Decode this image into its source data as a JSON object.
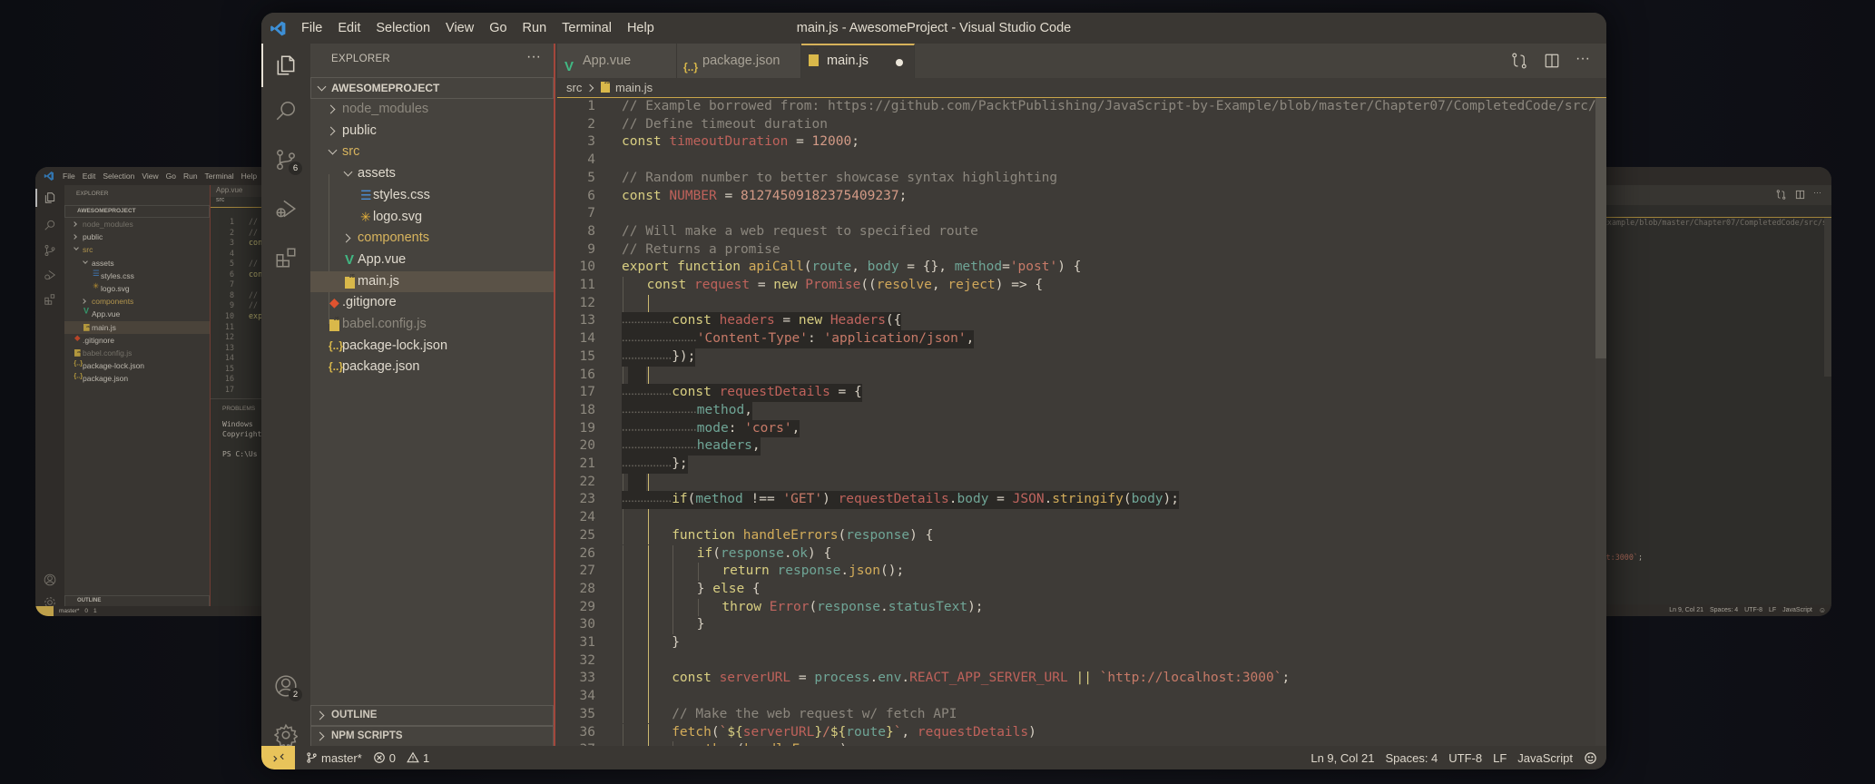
{
  "window": {
    "title": "main.js - AwesomeProject - Visual Studio Code",
    "menu": [
      "File",
      "Edit",
      "Selection",
      "View",
      "Go",
      "Run",
      "Terminal",
      "Help"
    ]
  },
  "activity_bar": {
    "items": [
      {
        "icon": "files-icon",
        "active": true
      },
      {
        "icon": "search-icon"
      },
      {
        "icon": "source-control-icon",
        "badge": "6"
      },
      {
        "icon": "run-debug-icon"
      },
      {
        "icon": "extensions-icon"
      }
    ],
    "accounts_badge": "2",
    "bottom": [
      "accounts-icon",
      "gear-icon"
    ]
  },
  "explorer": {
    "title": "EXPLORER",
    "more": "···",
    "project": "AWESOMEPROJECT",
    "items": [
      {
        "label": "node_modules",
        "type": "folder",
        "level": 0,
        "expanded": false,
        "state": "ignored"
      },
      {
        "label": "public",
        "type": "folder",
        "level": 0,
        "expanded": false
      },
      {
        "label": "src",
        "type": "folder",
        "level": 0,
        "expanded": true,
        "state": "modified"
      },
      {
        "label": "assets",
        "type": "folder",
        "level": 1,
        "expanded": true
      },
      {
        "label": "styles.css",
        "type": "file",
        "level": 2,
        "icon": "css"
      },
      {
        "label": "logo.svg",
        "type": "file",
        "level": 2,
        "icon": "svg"
      },
      {
        "label": "components",
        "type": "folder",
        "level": 1,
        "expanded": false,
        "state": "modified"
      },
      {
        "label": "App.vue",
        "type": "file",
        "level": 1,
        "icon": "vue"
      },
      {
        "label": "main.js",
        "type": "file",
        "level": 1,
        "icon": "js",
        "selected": true
      },
      {
        "label": ".gitignore",
        "type": "file",
        "level": 0,
        "icon": "git"
      },
      {
        "label": "babel.config.js",
        "type": "file",
        "level": 0,
        "icon": "js",
        "state": "ignored"
      },
      {
        "label": "package-lock.json",
        "type": "file",
        "level": 0,
        "icon": "json"
      },
      {
        "label": "package.json",
        "type": "file",
        "level": 0,
        "icon": "json"
      }
    ],
    "outline": "OUTLINE",
    "npm_scripts": "NPM SCRIPTS"
  },
  "tabs": [
    {
      "label": "App.vue",
      "icon": "vue"
    },
    {
      "label": "package.json",
      "icon": "json"
    },
    {
      "label": "main.js",
      "icon": "js",
      "active": true,
      "dirty": true
    }
  ],
  "editor_actions": [
    "open-changes-icon",
    "split-editor-icon",
    "more-actions-icon"
  ],
  "breadcrumb": {
    "folder": "src",
    "file": "main.js"
  },
  "theme": {
    "accent": "#e8c35a",
    "c": "#8c877e",
    "k": "#d9cf82",
    "v": "#bf625b",
    "n": "#d39a86",
    "s": "#c77a68",
    "f": "#d4ad5a",
    "p": "#6fa596",
    "t": "#c0655f",
    "g": "#d0a75a",
    "o": "#d6cfc2"
  },
  "editor": {
    "active_guide_level": 1,
    "lines": [
      {
        "ind": 0,
        "t": [
          [
            "c",
            "// Example borrowed from: https://github.com/PacktPublishing/JavaScript-by-Example/blob/master/Chapter07/CompletedCode/src/se"
          ]
        ]
      },
      {
        "ind": 0,
        "t": [
          [
            "c",
            "// Define timeout duration"
          ]
        ]
      },
      {
        "ind": 0,
        "t": [
          [
            "k",
            "const "
          ],
          [
            "v",
            "timeoutDuration"
          ],
          [
            "o",
            " = "
          ],
          [
            "n",
            "12000"
          ],
          [
            "o",
            ";"
          ]
        ]
      },
      {
        "ind": 0,
        "t": []
      },
      {
        "ind": 0,
        "t": [
          [
            "c",
            "// Random number to better showcase syntax highlighting"
          ]
        ]
      },
      {
        "ind": 0,
        "t": [
          [
            "k",
            "const "
          ],
          [
            "v",
            "NUMBER"
          ],
          [
            "o",
            " = "
          ],
          [
            "n",
            "81274509182375409237"
          ],
          [
            "o",
            ";"
          ]
        ]
      },
      {
        "ind": 0,
        "t": []
      },
      {
        "ind": 0,
        "t": [
          [
            "c",
            "// Will make a web request to specified route"
          ]
        ]
      },
      {
        "ind": 0,
        "t": [
          [
            "c",
            "// Returns a promise"
          ]
        ]
      },
      {
        "ind": 0,
        "t": [
          [
            "k",
            "export function "
          ],
          [
            "f",
            "apiCall"
          ],
          [
            "o",
            "("
          ],
          [
            "p",
            "route"
          ],
          [
            "o",
            ", "
          ],
          [
            "p",
            "body"
          ],
          [
            "o",
            " = {}, "
          ],
          [
            "p",
            "method"
          ],
          [
            "o",
            "="
          ],
          [
            "s",
            "'post'"
          ],
          [
            "o",
            ") {"
          ]
        ]
      },
      {
        "ind": 4,
        "t": [
          [
            "k",
            "const "
          ],
          [
            "v",
            "request"
          ],
          [
            "o",
            " = "
          ],
          [
            "k",
            "new "
          ],
          [
            "t",
            "Promise"
          ],
          [
            "o",
            "(("
          ],
          [
            "g",
            "resolve"
          ],
          [
            "o",
            ", "
          ],
          [
            "g",
            "reject"
          ],
          [
            "o",
            ") => {"
          ]
        ]
      },
      {
        "ind": 8,
        "blank": true,
        "t": []
      },
      {
        "ind": 8,
        "hl": true,
        "t": [
          [
            "k",
            "const "
          ],
          [
            "v",
            "headers"
          ],
          [
            "o",
            " = "
          ],
          [
            "k",
            "new "
          ],
          [
            "t",
            "Headers"
          ],
          [
            "o",
            "({"
          ]
        ]
      },
      {
        "ind": 12,
        "hl": true,
        "t": [
          [
            "s",
            "'Content-Type'"
          ],
          [
            "o",
            ": "
          ],
          [
            "s",
            "'application/json'"
          ],
          [
            "o",
            ","
          ]
        ]
      },
      {
        "ind": 8,
        "hl": true,
        "t": [
          [
            "o",
            "});"
          ]
        ]
      },
      {
        "ind": 8,
        "hl": true,
        "blank": true,
        "t": []
      },
      {
        "ind": 8,
        "hl": true,
        "t": [
          [
            "k",
            "const "
          ],
          [
            "v",
            "requestDetails"
          ],
          [
            "o",
            " = {"
          ]
        ]
      },
      {
        "ind": 12,
        "hl": true,
        "t": [
          [
            "p",
            "method"
          ],
          [
            "o",
            ","
          ]
        ]
      },
      {
        "ind": 12,
        "hl": true,
        "t": [
          [
            "p",
            "mode"
          ],
          [
            "o",
            ": "
          ],
          [
            "s",
            "'cors'"
          ],
          [
            "o",
            ","
          ]
        ]
      },
      {
        "ind": 12,
        "hl": true,
        "t": [
          [
            "p",
            "headers"
          ],
          [
            "o",
            ","
          ]
        ]
      },
      {
        "ind": 8,
        "hl": true,
        "t": [
          [
            "o",
            "};"
          ]
        ]
      },
      {
        "ind": 8,
        "hl": true,
        "blank": true,
        "t": []
      },
      {
        "ind": 8,
        "hl": true,
        "t": [
          [
            "k",
            "if"
          ],
          [
            "o",
            "("
          ],
          [
            "p",
            "method"
          ],
          [
            "o",
            " !== "
          ],
          [
            "s",
            "'GET'"
          ],
          [
            "o",
            ") "
          ],
          [
            "v",
            "requestDetails"
          ],
          [
            "o",
            "."
          ],
          [
            "p",
            "body"
          ],
          [
            "o",
            " = "
          ],
          [
            "t",
            "JSON"
          ],
          [
            "o",
            "."
          ],
          [
            "f",
            "stringify"
          ],
          [
            "o",
            "("
          ],
          [
            "p",
            "body"
          ],
          [
            "o",
            ");"
          ]
        ]
      },
      {
        "ind": 8,
        "blank": true,
        "t": []
      },
      {
        "ind": 8,
        "t": [
          [
            "k",
            "function "
          ],
          [
            "f",
            "handleErrors"
          ],
          [
            "o",
            "("
          ],
          [
            "p",
            "response"
          ],
          [
            "o",
            ") {"
          ]
        ]
      },
      {
        "ind": 12,
        "t": [
          [
            "k",
            "if"
          ],
          [
            "o",
            "("
          ],
          [
            "p",
            "response"
          ],
          [
            "o",
            "."
          ],
          [
            "p",
            "ok"
          ],
          [
            "o",
            ") {"
          ]
        ]
      },
      {
        "ind": 16,
        "t": [
          [
            "k",
            "return "
          ],
          [
            "p",
            "response"
          ],
          [
            "o",
            "."
          ],
          [
            "f",
            "json"
          ],
          [
            "o",
            "();"
          ]
        ]
      },
      {
        "ind": 12,
        "t": [
          [
            "o",
            "} "
          ],
          [
            "k",
            "else"
          ],
          [
            "o",
            " {"
          ]
        ]
      },
      {
        "ind": 16,
        "t": [
          [
            "k",
            "throw "
          ],
          [
            "t",
            "Error"
          ],
          [
            "o",
            "("
          ],
          [
            "p",
            "response"
          ],
          [
            "o",
            "."
          ],
          [
            "p",
            "statusText"
          ],
          [
            "o",
            ");"
          ]
        ]
      },
      {
        "ind": 12,
        "t": [
          [
            "o",
            "}"
          ]
        ]
      },
      {
        "ind": 8,
        "t": [
          [
            "o",
            "}"
          ]
        ]
      },
      {
        "ind": 8,
        "blank": true,
        "t": []
      },
      {
        "ind": 8,
        "t": [
          [
            "k",
            "const "
          ],
          [
            "v",
            "serverURL"
          ],
          [
            "o",
            " = "
          ],
          [
            "p",
            "process"
          ],
          [
            "o",
            "."
          ],
          [
            "p",
            "env"
          ],
          [
            "o",
            "."
          ],
          [
            "v",
            "REACT_APP_SERVER_URL"
          ],
          [
            "o",
            " "
          ],
          [
            "k",
            "||"
          ],
          [
            "o",
            " "
          ],
          [
            "s",
            "`http://localhost:3000`"
          ],
          [
            "o",
            ";"
          ]
        ]
      },
      {
        "ind": 8,
        "blank": true,
        "t": []
      },
      {
        "ind": 8,
        "t": [
          [
            "c",
            "// Make the web request w/ fetch API"
          ]
        ]
      },
      {
        "ind": 8,
        "t": [
          [
            "f",
            "fetch"
          ],
          [
            "o",
            "("
          ],
          [
            "s",
            "`"
          ],
          [
            "k",
            "${"
          ],
          [
            "v",
            "serverURL"
          ],
          [
            "k",
            "}"
          ],
          [
            "s",
            "/"
          ],
          [
            "k",
            "${"
          ],
          [
            "p",
            "route"
          ],
          [
            "k",
            "}"
          ],
          [
            "s",
            "`"
          ],
          [
            "o",
            ", "
          ],
          [
            "v",
            "requestDetails"
          ],
          [
            "o",
            ")"
          ]
        ]
      },
      {
        "ind": 12,
        "t": [
          [
            "o",
            "."
          ],
          [
            "f",
            "then"
          ],
          [
            "o",
            "("
          ],
          [
            "f",
            "handleErrors"
          ],
          [
            "o",
            ")"
          ]
        ]
      }
    ]
  },
  "statusbar": {
    "branch": "master*",
    "errors": "0",
    "warnings": "1",
    "position": "Ln 9, Col 21",
    "spaces": "Spaces: 4",
    "encoding": "UTF-8",
    "eol": "LF",
    "language": "JavaScript"
  },
  "background_left": {
    "panel_title": "PROBLEMS",
    "terminal": [
      "Windows",
      "Copyright",
      "",
      "PS C:\\Us"
    ]
  }
}
